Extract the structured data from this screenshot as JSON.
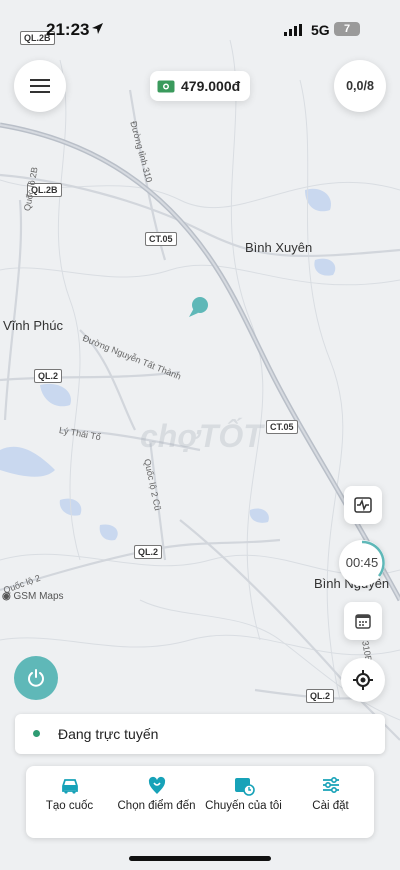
{
  "status": {
    "time": "21:23",
    "network": "5G",
    "battery": "7"
  },
  "header": {
    "wallet_amount": "479.000đ",
    "counter": "0,0/8"
  },
  "map": {
    "places": [
      "Bình Xuyên",
      "Vĩnh Phúc",
      "Bình Nguyên"
    ],
    "road_tags": [
      "QL.2B",
      "CT.05",
      "QL.2",
      "CT.05",
      "QL.2",
      "QL.2"
    ],
    "road_names": [
      "Đường tỉnh 310",
      "Quốc lộ 2B",
      "Đường Nguyễn Tất Thành",
      "Lý Thái Tổ",
      "Quốc lộ 2 Cũ",
      "Quốc lộ 2",
      "310B"
    ],
    "attribution": "GSM Maps",
    "watermark": "chợTỐT"
  },
  "timer": "00:45",
  "online_status": "Đang trực tuyến",
  "nav": [
    {
      "label": "Tạo cuốc",
      "icon": "car-icon"
    },
    {
      "label": "Chọn điểm đến",
      "icon": "heart-pin-icon"
    },
    {
      "label": "Chuyến của tôi",
      "icon": "calendar-clock-icon"
    },
    {
      "label": "Cài đặt",
      "icon": "sliders-icon"
    }
  ],
  "colors": {
    "accent": "#5fb8b8",
    "online": "#2e9b72",
    "highway": "#b9bfc8"
  }
}
